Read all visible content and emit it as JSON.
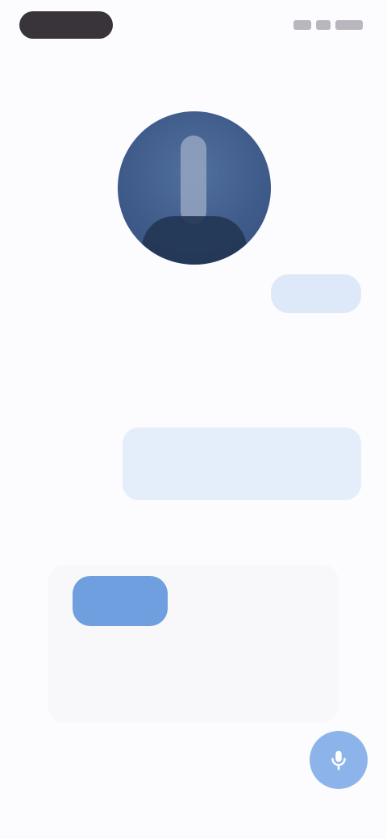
{
  "status_bar": {
    "pill_label": "",
    "icons": [
      "signal-icon",
      "wifi-icon",
      "battery-icon"
    ]
  },
  "chat": {
    "header": "",
    "avatar_caption": "",
    "out_chip": "",
    "in_message": "",
    "out_card_lines": [
      "",
      ""
    ],
    "question": ""
  },
  "options": {
    "primary": "",
    "right_label": "",
    "row": [
      "",
      ""
    ],
    "bottom": ""
  },
  "fab": {
    "icon": "mic-icon"
  },
  "colors": {
    "accent": "#6f9fdf",
    "fab": "#8db4ea",
    "chip_bg": "#dde8f8",
    "card_bg": "#e4edfa",
    "avatar": "#3f5c8b"
  }
}
